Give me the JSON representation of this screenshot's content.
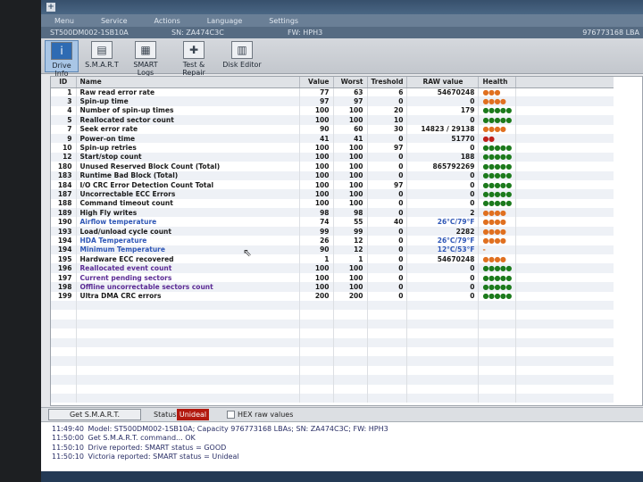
{
  "menu": [
    "Menu",
    "Service",
    "Actions",
    "Language",
    "Settings"
  ],
  "drive": {
    "model": "ST500DM002-1SB10A",
    "sn": "SN: ZA474C3C",
    "fw": "FW: HPH3",
    "lba": "976773168 LBA"
  },
  "toolbar": {
    "drive_info": "Drive Info",
    "smart": "S.M.A.R.T",
    "smart_logs": "SMART Logs",
    "test_repair": "Test & Repair",
    "disk_editor": "Disk Editor"
  },
  "columns": [
    "ID",
    "Name",
    "Value",
    "Worst",
    "Treshold",
    "RAW value",
    "Health"
  ],
  "rows": [
    {
      "id": "1",
      "name": "Raw read error rate",
      "value": "77",
      "worst": "63",
      "tres": "6",
      "raw": "54670248",
      "health": "●●●",
      "hc": "#e07020"
    },
    {
      "id": "3",
      "name": "Spin-up time",
      "value": "97",
      "worst": "97",
      "tres": "0",
      "raw": "0",
      "health": "●●●●",
      "hc": "#e07020"
    },
    {
      "id": "4",
      "name": "Number of spin-up times",
      "value": "100",
      "worst": "100",
      "tres": "20",
      "raw": "179",
      "health": "●●●●●",
      "hc": "#1c7a1c"
    },
    {
      "id": "5",
      "name": "Reallocated sector count",
      "value": "100",
      "worst": "100",
      "tres": "10",
      "raw": "0",
      "health": "●●●●●",
      "hc": "#1c7a1c"
    },
    {
      "id": "7",
      "name": "Seek error rate",
      "value": "90",
      "worst": "60",
      "tres": "30",
      "raw": "14823 / 29138",
      "health": "●●●●",
      "hc": "#e07020"
    },
    {
      "id": "9",
      "name": "Power-on time",
      "value": "41",
      "worst": "41",
      "tres": "0",
      "raw": "51770",
      "health": "●●",
      "hc": "#c0201a"
    },
    {
      "id": "10",
      "name": "Spin-up retries",
      "value": "100",
      "worst": "100",
      "tres": "97",
      "raw": "0",
      "health": "●●●●●",
      "hc": "#1c7a1c"
    },
    {
      "id": "12",
      "name": "Start/stop count",
      "value": "100",
      "worst": "100",
      "tres": "0",
      "raw": "188",
      "health": "●●●●●",
      "hc": "#1c7a1c"
    },
    {
      "id": "180",
      "name": "Unused Reserved Block Count (Total)",
      "value": "100",
      "worst": "100",
      "tres": "0",
      "raw": "865792269",
      "health": "●●●●●",
      "hc": "#1c7a1c"
    },
    {
      "id": "183",
      "name": "Runtime Bad Block (Total)",
      "value": "100",
      "worst": "100",
      "tres": "0",
      "raw": "0",
      "health": "●●●●●",
      "hc": "#1c7a1c"
    },
    {
      "id": "184",
      "name": "I/O CRC Error Detection Count Total",
      "value": "100",
      "worst": "100",
      "tres": "97",
      "raw": "0",
      "health": "●●●●●",
      "hc": "#1c7a1c"
    },
    {
      "id": "187",
      "name": "Uncorrectable ECC Errors",
      "value": "100",
      "worst": "100",
      "tres": "0",
      "raw": "0",
      "health": "●●●●●",
      "hc": "#1c7a1c"
    },
    {
      "id": "188",
      "name": "Command timeout count",
      "value": "100",
      "worst": "100",
      "tres": "0",
      "raw": "0",
      "health": "●●●●●",
      "hc": "#1c7a1c"
    },
    {
      "id": "189",
      "name": "High Fly writes",
      "value": "98",
      "worst": "98",
      "tres": "0",
      "raw": "2",
      "health": "●●●●",
      "hc": "#e07020"
    },
    {
      "id": "190",
      "name": "Airflow temperature",
      "value": "74",
      "worst": "55",
      "tres": "40",
      "raw": "26°C/79°F",
      "health": "●●●●",
      "hc": "#e07020",
      "nc": "blue",
      "rc": "blue"
    },
    {
      "id": "193",
      "name": "Load/unload cycle count",
      "value": "99",
      "worst": "99",
      "tres": "0",
      "raw": "2282",
      "health": "●●●●",
      "hc": "#e07020"
    },
    {
      "id": "194",
      "name": "HDA Temperature",
      "value": "26",
      "worst": "12",
      "tres": "0",
      "raw": "26°C/79°F",
      "health": "●●●●",
      "hc": "#e07020",
      "nc": "blue",
      "rc": "blue"
    },
    {
      "id": "194",
      "name": "Minimum Temperature",
      "value": "90",
      "worst": "12",
      "tres": "0",
      "raw": "12°C/53°F",
      "health": "-",
      "hc": "#e07020",
      "nc": "blue",
      "rc": "blue"
    },
    {
      "id": "195",
      "name": "Hardware ECC recovered",
      "value": "1",
      "worst": "1",
      "tres": "0",
      "raw": "54670248",
      "health": "●●●●",
      "hc": "#e07020"
    },
    {
      "id": "196",
      "name": "Reallocated event count",
      "value": "100",
      "worst": "100",
      "tres": "0",
      "raw": "0",
      "health": "●●●●●",
      "hc": "#1c7a1c",
      "nc": "purple"
    },
    {
      "id": "197",
      "name": "Current pending sectors",
      "value": "100",
      "worst": "100",
      "tres": "0",
      "raw": "0",
      "health": "●●●●●",
      "hc": "#1c7a1c",
      "nc": "purple"
    },
    {
      "id": "198",
      "name": "Offline uncorrectable sectors count",
      "value": "100",
      "worst": "100",
      "tres": "0",
      "raw": "0",
      "health": "●●●●●",
      "hc": "#1c7a1c",
      "nc": "purple"
    },
    {
      "id": "199",
      "name": "Ultra DMA CRC errors",
      "value": "200",
      "worst": "200",
      "tres": "0",
      "raw": "0",
      "health": "●●●●●",
      "hc": "#1c7a1c"
    }
  ],
  "status": {
    "get_smart": "Get S.M.A.R.T.",
    "label": "Status:",
    "value": "Unideal",
    "hex_label": "HEX raw values"
  },
  "log": [
    {
      "time": "11:49:40",
      "text": "Model: ST500DM002-1SB10A; Capacity 976773168 LBAs; SN: ZA474C3C; FW: HPH3"
    },
    {
      "time": "11:50:00",
      "text": "Get S.M.A.R.T. command... OK"
    },
    {
      "time": "11:50:10",
      "text": "Drive reported: SMART status = GOOD"
    },
    {
      "time": "11:50:10",
      "text": "Victoria reported: SMART status = Unideal"
    }
  ],
  "watermark": "Avito",
  "colors": {
    "status_bad": "#b2190f",
    "health_good": "#1c7a1c",
    "health_warn": "#e07020",
    "health_bad": "#c0201a"
  }
}
